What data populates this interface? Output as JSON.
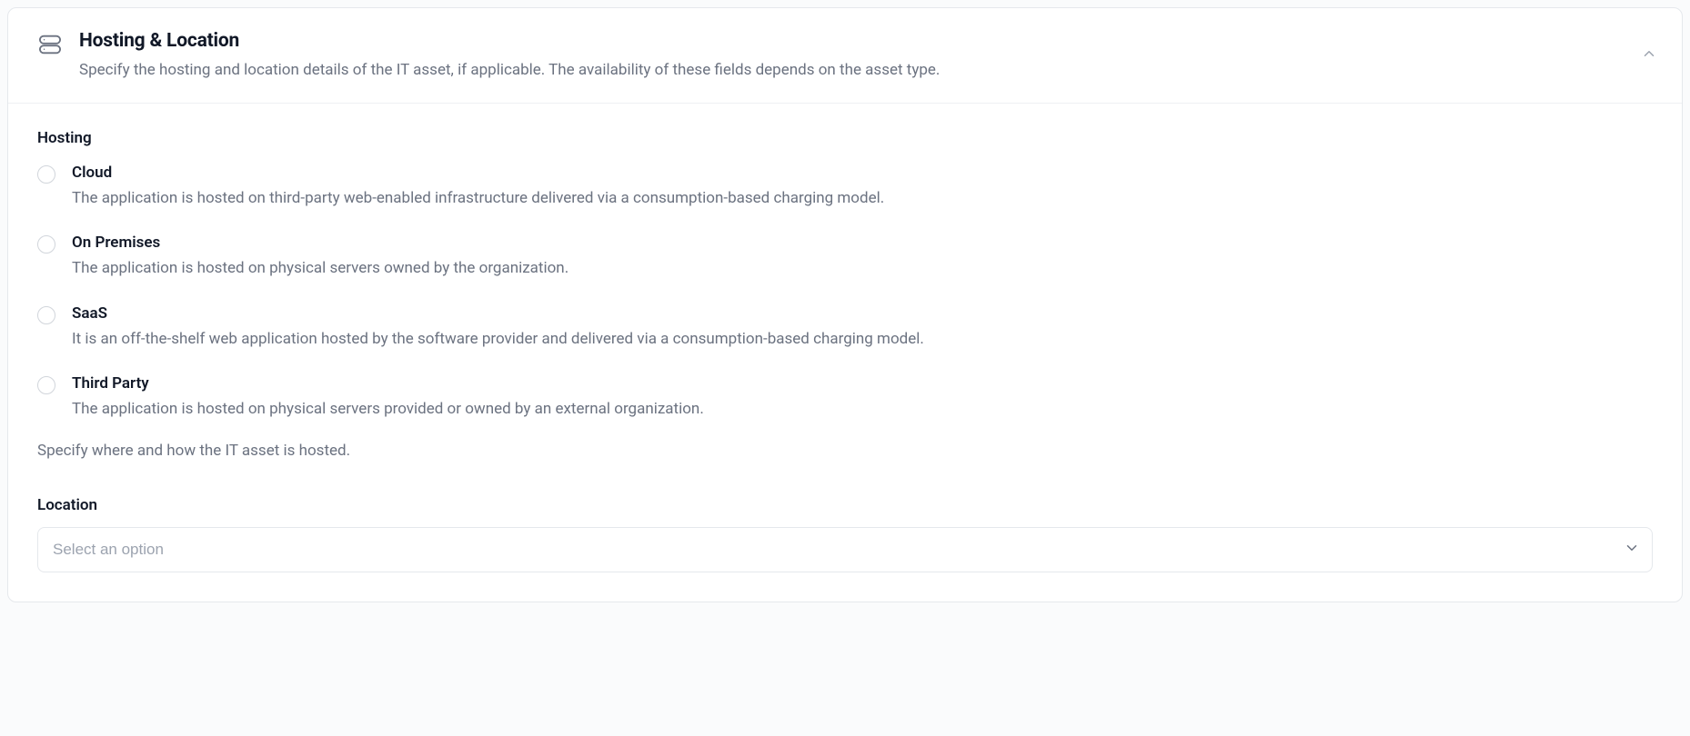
{
  "panel": {
    "title": "Hosting & Location",
    "subtitle": "Specify the hosting and location details of the IT asset, if applicable. The availability of these fields depends on the asset type."
  },
  "hosting": {
    "label": "Hosting",
    "options": [
      {
        "title": "Cloud",
        "desc": "The application is hosted on third-party web-enabled infrastructure delivered via a consumption-based charging model."
      },
      {
        "title": "On Premises",
        "desc": "The application is hosted on physical servers owned by the organization."
      },
      {
        "title": "SaaS",
        "desc": "It is an off-the-shelf web application hosted by the software provider and delivered via a consumption-based charging model."
      },
      {
        "title": "Third Party",
        "desc": "The application is hosted on physical servers provided or owned by an external organization."
      }
    ],
    "helper": "Specify where and how the IT asset is hosted."
  },
  "location": {
    "label": "Location",
    "placeholder": "Select an option"
  }
}
